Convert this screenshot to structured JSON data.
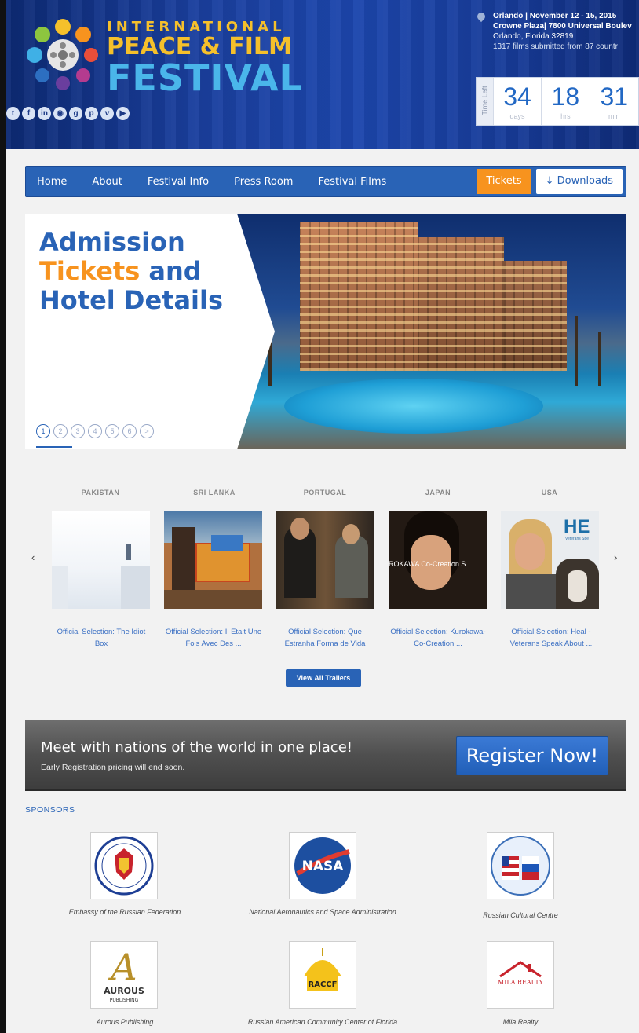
{
  "header": {
    "logo_line1": "INTERNATIONAL",
    "logo_line2": "PEACE & FILM",
    "logo_line3": "FESTIVAL",
    "social_icons": [
      "twitter-icon",
      "facebook-icon",
      "linkedin-icon",
      "rss-icon",
      "google-plus-icon",
      "pinterest-icon",
      "vimeo-icon",
      "youtube-icon"
    ],
    "event_line1": "Orlando | November 12 - 15, 2015",
    "event_line2": "Crowne Plaza| 7800 Universal Boulev",
    "event_line3": "Orlando, Florida 32819",
    "event_line4": "1317 films submitted from 87 countr",
    "countdown": {
      "side_label": "Time Left",
      "days": "34",
      "days_label": "days",
      "hrs": "18",
      "hrs_label": "hrs",
      "min": "31",
      "min_label": "min"
    }
  },
  "nav": {
    "items": [
      "Home",
      "About",
      "Festival Info",
      "Press Room",
      "Festival Films"
    ],
    "tickets": "Tickets",
    "downloads": "↓ Downloads"
  },
  "hero": {
    "title_line1": "Admission",
    "title_word_orange": "Tickets",
    "title_word_and": " and",
    "title_line3": "Hotel Details",
    "pages": [
      "1",
      "2",
      "3",
      "4",
      "5",
      "6",
      ">"
    ]
  },
  "trailers": {
    "prev": "‹",
    "next": "›",
    "items": [
      {
        "country": "PAKISTAN",
        "caption": "Official Selection: The Idiot Box"
      },
      {
        "country": "SRI LANKA",
        "caption": "Official Selection: Il Était Une Fois Avec Des ..."
      },
      {
        "country": "PORTUGAL",
        "caption": "Official Selection: Que Estranha Forma de Vida"
      },
      {
        "country": "JAPAN",
        "caption": "Official Selection: Kurokawa- Co-Creation ..."
      },
      {
        "country": "USA",
        "caption": "Official Selection: Heal - Veterans Speak About ..."
      }
    ],
    "thumb_texts": {
      "japan": "ROKAWA Co-Creation S",
      "usa": "HE",
      "usa_sub": "Veterans Spe"
    },
    "view_all": "View All Trailers"
  },
  "banner": {
    "title": "Meet with nations of the world in one place!",
    "subtitle": "Early Registration pricing will end soon.",
    "register": "Register Now!"
  },
  "sponsors": {
    "title": "SPONSORS",
    "items": [
      {
        "name": "Embassy of the Russian Federation",
        "logo": "russian-embassy-seal"
      },
      {
        "name": "National Aeronautics and Space Administration",
        "logo": "nasa-meatball",
        "logo_text": "NASA"
      },
      {
        "name": "Russian Cultural Centre",
        "logo": "russian-cultural-centre-seal"
      },
      {
        "name": "Aurous Publishing",
        "logo": "aurous-publishing",
        "logo_text": "AUROUS",
        "logo_sub": "PUBLISHING"
      },
      {
        "name": "Russian American Community Center of Florida",
        "logo": "raccf-dome",
        "logo_text": "RACCF"
      },
      {
        "name": "Mila Realty",
        "logo": "mila-realty-roof",
        "logo_text": "MILA REALTY"
      }
    ]
  }
}
